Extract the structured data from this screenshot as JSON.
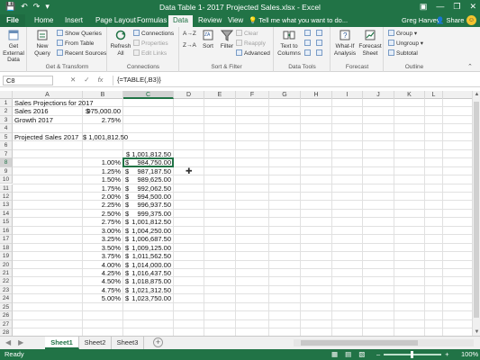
{
  "window": {
    "title": "Data Table 1- 2017 Projected Sales.xlsx - Excel",
    "qat_icons": [
      "save-icon",
      "undo-icon",
      "redo-icon",
      "customize-qat-icon"
    ],
    "controls": [
      "minimize",
      "restore",
      "close"
    ]
  },
  "ribbon_tabs": [
    "File",
    "Home",
    "Insert",
    "Page Layout",
    "Formulas",
    "Data",
    "Review",
    "View"
  ],
  "active_tab": "Data",
  "tell_me": "Tell me what you want to do...",
  "user": "Greg Harvey",
  "share": "Share",
  "ribbon": {
    "get_external_data": "Get External Data",
    "new_query": "New Query",
    "show_queries": "Show Queries",
    "from_table": "From Table",
    "recent_sources": "Recent Sources",
    "get_transform": "Get & Transform",
    "refresh_all": "Refresh All",
    "connections": "Connections",
    "properties": "Properties",
    "edit_links": "Edit Links",
    "connections_group": "Connections",
    "sort_az": "A→Z",
    "sort_za": "Z→A",
    "sort": "Sort",
    "filter": "Filter",
    "clear": "Clear",
    "reapply": "Reapply",
    "advanced": "Advanced",
    "sort_filter": "Sort & Filter",
    "text_to_columns": "Text to Columns",
    "data_tools": "Data Tools",
    "what_if": "What-If Analysis",
    "forecast_sheet": "Forecast Sheet",
    "forecast": "Forecast",
    "group": "Group",
    "ungroup": "Ungroup",
    "subtotal": "Subtotal",
    "outline": "Outline"
  },
  "formula_bar": {
    "name_box": "C8",
    "icons": [
      "cancel-icon",
      "enter-icon",
      "fx-icon"
    ],
    "formula": "{=TABLE(,B3)}"
  },
  "columns": [
    "A",
    "B",
    "C",
    "D",
    "E",
    "F",
    "G",
    "H",
    "I",
    "J",
    "K",
    "L"
  ],
  "selected_column": "C",
  "rows": [
    "1",
    "2",
    "3",
    "4",
    "5",
    "6",
    "7",
    "8",
    "9",
    "10",
    "11",
    "12",
    "13",
    "14",
    "15",
    "16",
    "17",
    "18",
    "19",
    "20",
    "21",
    "22",
    "23",
    "24",
    "25",
    "26",
    "27",
    "28"
  ],
  "selected_row": "8",
  "cells": {
    "a1": "Sales Projections for 2017",
    "a2": "Sales 2016",
    "b2_sym": "$",
    "b2_val": "975,000.00",
    "a3": "Growth 2017",
    "b3": "2.75%",
    "a5": "Projected Sales 2017",
    "b5": "$ 1,001,812.50",
    "c7": "$ 1,001,812.50"
  },
  "table": [
    {
      "rate": "1.00%",
      "sym": "$",
      "value": "984,750.00"
    },
    {
      "rate": "1.25%",
      "sym": "$",
      "value": "987,187.50"
    },
    {
      "rate": "1.50%",
      "sym": "$",
      "value": "989,625.00"
    },
    {
      "rate": "1.75%",
      "sym": "$",
      "value": "992,062.50"
    },
    {
      "rate": "2.00%",
      "sym": "$",
      "value": "994,500.00"
    },
    {
      "rate": "2.25%",
      "sym": "$",
      "value": "996,937.50"
    },
    {
      "rate": "2.50%",
      "sym": "$",
      "value": "999,375.00"
    },
    {
      "rate": "2.75%",
      "sym": "$",
      "value": "1,001,812.50"
    },
    {
      "rate": "3.00%",
      "sym": "$",
      "value": "1,004,250.00"
    },
    {
      "rate": "3.25%",
      "sym": "$",
      "value": "1,006,687.50"
    },
    {
      "rate": "3.50%",
      "sym": "$",
      "value": "1,009,125.00"
    },
    {
      "rate": "3.75%",
      "sym": "$",
      "value": "1,011,562.50"
    },
    {
      "rate": "4.00%",
      "sym": "$",
      "value": "1,014,000.00"
    },
    {
      "rate": "4.25%",
      "sym": "$",
      "value": "1,016,437.50"
    },
    {
      "rate": "4.50%",
      "sym": "$",
      "value": "1,018,875.00"
    },
    {
      "rate": "4.75%",
      "sym": "$",
      "value": "1,021,312.50"
    },
    {
      "rate": "5.00%",
      "sym": "$",
      "value": "1,023,750.00"
    }
  ],
  "sheets": [
    "Sheet1",
    "Sheet2",
    "Sheet3"
  ],
  "active_sheet": "Sheet1",
  "status": {
    "ready": "Ready",
    "zoom": "100%"
  },
  "colors": {
    "excel_green": "#217346",
    "selection": "#217346"
  }
}
